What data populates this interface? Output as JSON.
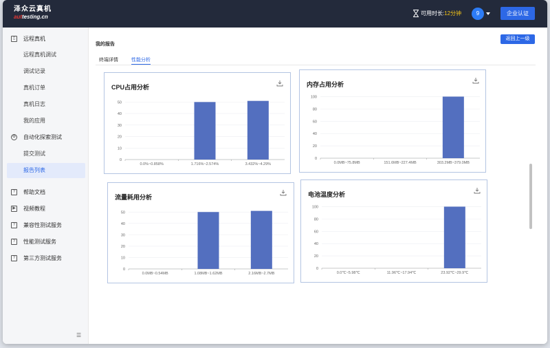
{
  "header": {
    "logo_cn": "泽众云真机",
    "logo_en_prefix": "aut",
    "logo_en_rest": "testing.cn",
    "time_label": "可用时长:",
    "time_value": "12分钟",
    "avatar_text": "9",
    "enterprise_button": "企业认证"
  },
  "sidebar": {
    "sections": [
      {
        "label": "远程真机",
        "icon": "phone-icon"
      },
      {
        "label": "自动化探索测试",
        "icon": "gear-icon"
      },
      {
        "label": "帮助文档",
        "icon": "help-icon"
      },
      {
        "label": "视频教程",
        "icon": "video-icon"
      },
      {
        "label": "兼容性测试服务",
        "icon": "help-icon"
      },
      {
        "label": "性能测试服务",
        "icon": "help-icon"
      },
      {
        "label": "第三方测试服务",
        "icon": "help-icon"
      }
    ],
    "subitems": [
      {
        "label": "远程真机调试"
      },
      {
        "label": "调试记录"
      },
      {
        "label": "真机订单"
      },
      {
        "label": "真机日志"
      },
      {
        "label": "我的应用"
      },
      {
        "label": "提交测试"
      },
      {
        "label": "报告列表"
      }
    ]
  },
  "main": {
    "page_title": "我的报告",
    "back_button": "返回上一级",
    "tabs": [
      {
        "label": "终端详情"
      },
      {
        "label": "性能分析"
      }
    ]
  },
  "chart_data": [
    {
      "type": "bar",
      "title": "CPU占用分析",
      "categories": [
        "0.0%~0.858%",
        "1.716%~2.574%",
        "3.432%~4.29%"
      ],
      "values": [
        0,
        50,
        51
      ],
      "y_ticks": [
        0,
        10,
        20,
        30,
        40,
        50
      ],
      "ylim": [
        0,
        55
      ],
      "color": "#536fbf"
    },
    {
      "type": "bar",
      "title": "内存占用分析",
      "categories": [
        "0.0MB~75.8MB",
        "151.6MB~227.4MB",
        "303.2MB~379.0MB"
      ],
      "values": [
        0,
        0,
        100
      ],
      "y_ticks": [
        0,
        20,
        40,
        60,
        80,
        100
      ],
      "ylim": [
        0,
        105
      ],
      "color": "#536fbf"
    },
    {
      "type": "bar",
      "title": "流量耗用分析",
      "categories": [
        "0.0MB~0.54MB",
        "1.08MB~1.62MB",
        "2.16MB~2.7MB"
      ],
      "values": [
        0,
        50,
        51
      ],
      "y_ticks": [
        0,
        10,
        20,
        30,
        40,
        50
      ],
      "ylim": [
        0,
        55
      ],
      "color": "#536fbf"
    },
    {
      "type": "bar",
      "title": "电池温度分析",
      "categories": [
        "0.0℃~5.98℃",
        "11.96℃~17.94℃",
        "23.92℃~29.9℃"
      ],
      "values": [
        0,
        0,
        100
      ],
      "y_ticks": [
        0,
        20,
        40,
        60,
        80,
        100
      ],
      "ylim": [
        0,
        105
      ],
      "color": "#536fbf"
    }
  ]
}
